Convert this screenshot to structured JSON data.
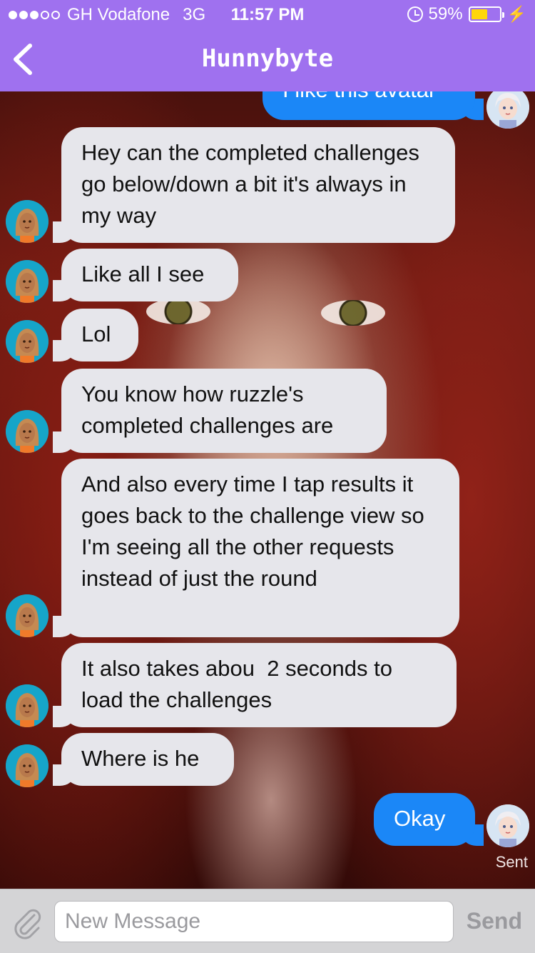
{
  "status_bar": {
    "carrier": "GH Vodafone",
    "network": "3G",
    "time": "11:57 PM",
    "battery_percent": "59%",
    "battery_level": 0.59,
    "signal_bars": 3
  },
  "nav": {
    "title": "Hunnybyte",
    "back_icon": "chevron-left-icon"
  },
  "messages": [
    {
      "from": "me",
      "text": "I like this avatar"
    },
    {
      "from": "them",
      "text": "Hey can the completed challenges go below/down a bit it's always in my way"
    },
    {
      "from": "them",
      "text": "Like all I see"
    },
    {
      "from": "them",
      "text": "Lol"
    },
    {
      "from": "them",
      "text": "You know how ruzzle's completed challenges are"
    },
    {
      "from": "them",
      "text": "And also every time I tap results it goes back to the challenge view so I'm seeing all the other requests instead of just the round"
    },
    {
      "from": "them",
      "text": "It also takes abou  2 seconds to load the challenges"
    },
    {
      "from": "them",
      "text": "Where is he"
    },
    {
      "from": "me",
      "text": "Okay"
    }
  ],
  "delivery_status": "Sent",
  "composer": {
    "placeholder": "New Message",
    "value": "",
    "send_label": "Send",
    "attach_icon": "paperclip-icon"
  },
  "colors": {
    "header": "#9f71ef",
    "outgoing_bubble": "#1b87f7",
    "incoming_bubble": "#e6e6eb"
  }
}
